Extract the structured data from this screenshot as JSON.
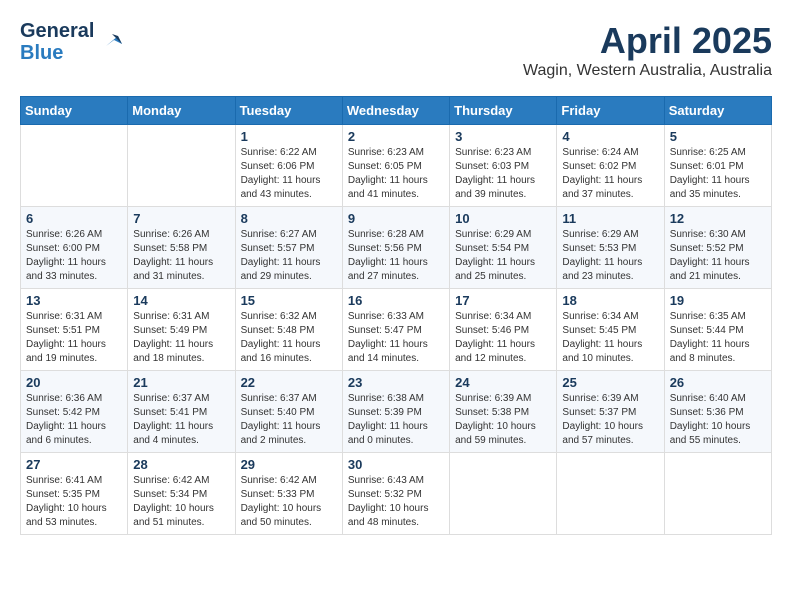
{
  "header": {
    "logo_line1": "General",
    "logo_line2": "Blue",
    "month": "April 2025",
    "location": "Wagin, Western Australia, Australia"
  },
  "weekdays": [
    "Sunday",
    "Monday",
    "Tuesday",
    "Wednesday",
    "Thursday",
    "Friday",
    "Saturday"
  ],
  "weeks": [
    [
      {
        "day": "",
        "sunrise": "",
        "sunset": "",
        "daylight": ""
      },
      {
        "day": "",
        "sunrise": "",
        "sunset": "",
        "daylight": ""
      },
      {
        "day": "1",
        "sunrise": "Sunrise: 6:22 AM",
        "sunset": "Sunset: 6:06 PM",
        "daylight": "Daylight: 11 hours and 43 minutes."
      },
      {
        "day": "2",
        "sunrise": "Sunrise: 6:23 AM",
        "sunset": "Sunset: 6:05 PM",
        "daylight": "Daylight: 11 hours and 41 minutes."
      },
      {
        "day": "3",
        "sunrise": "Sunrise: 6:23 AM",
        "sunset": "Sunset: 6:03 PM",
        "daylight": "Daylight: 11 hours and 39 minutes."
      },
      {
        "day": "4",
        "sunrise": "Sunrise: 6:24 AM",
        "sunset": "Sunset: 6:02 PM",
        "daylight": "Daylight: 11 hours and 37 minutes."
      },
      {
        "day": "5",
        "sunrise": "Sunrise: 6:25 AM",
        "sunset": "Sunset: 6:01 PM",
        "daylight": "Daylight: 11 hours and 35 minutes."
      }
    ],
    [
      {
        "day": "6",
        "sunrise": "Sunrise: 6:26 AM",
        "sunset": "Sunset: 6:00 PM",
        "daylight": "Daylight: 11 hours and 33 minutes."
      },
      {
        "day": "7",
        "sunrise": "Sunrise: 6:26 AM",
        "sunset": "Sunset: 5:58 PM",
        "daylight": "Daylight: 11 hours and 31 minutes."
      },
      {
        "day": "8",
        "sunrise": "Sunrise: 6:27 AM",
        "sunset": "Sunset: 5:57 PM",
        "daylight": "Daylight: 11 hours and 29 minutes."
      },
      {
        "day": "9",
        "sunrise": "Sunrise: 6:28 AM",
        "sunset": "Sunset: 5:56 PM",
        "daylight": "Daylight: 11 hours and 27 minutes."
      },
      {
        "day": "10",
        "sunrise": "Sunrise: 6:29 AM",
        "sunset": "Sunset: 5:54 PM",
        "daylight": "Daylight: 11 hours and 25 minutes."
      },
      {
        "day": "11",
        "sunrise": "Sunrise: 6:29 AM",
        "sunset": "Sunset: 5:53 PM",
        "daylight": "Daylight: 11 hours and 23 minutes."
      },
      {
        "day": "12",
        "sunrise": "Sunrise: 6:30 AM",
        "sunset": "Sunset: 5:52 PM",
        "daylight": "Daylight: 11 hours and 21 minutes."
      }
    ],
    [
      {
        "day": "13",
        "sunrise": "Sunrise: 6:31 AM",
        "sunset": "Sunset: 5:51 PM",
        "daylight": "Daylight: 11 hours and 19 minutes."
      },
      {
        "day": "14",
        "sunrise": "Sunrise: 6:31 AM",
        "sunset": "Sunset: 5:49 PM",
        "daylight": "Daylight: 11 hours and 18 minutes."
      },
      {
        "day": "15",
        "sunrise": "Sunrise: 6:32 AM",
        "sunset": "Sunset: 5:48 PM",
        "daylight": "Daylight: 11 hours and 16 minutes."
      },
      {
        "day": "16",
        "sunrise": "Sunrise: 6:33 AM",
        "sunset": "Sunset: 5:47 PM",
        "daylight": "Daylight: 11 hours and 14 minutes."
      },
      {
        "day": "17",
        "sunrise": "Sunrise: 6:34 AM",
        "sunset": "Sunset: 5:46 PM",
        "daylight": "Daylight: 11 hours and 12 minutes."
      },
      {
        "day": "18",
        "sunrise": "Sunrise: 6:34 AM",
        "sunset": "Sunset: 5:45 PM",
        "daylight": "Daylight: 11 hours and 10 minutes."
      },
      {
        "day": "19",
        "sunrise": "Sunrise: 6:35 AM",
        "sunset": "Sunset: 5:44 PM",
        "daylight": "Daylight: 11 hours and 8 minutes."
      }
    ],
    [
      {
        "day": "20",
        "sunrise": "Sunrise: 6:36 AM",
        "sunset": "Sunset: 5:42 PM",
        "daylight": "Daylight: 11 hours and 6 minutes."
      },
      {
        "day": "21",
        "sunrise": "Sunrise: 6:37 AM",
        "sunset": "Sunset: 5:41 PM",
        "daylight": "Daylight: 11 hours and 4 minutes."
      },
      {
        "day": "22",
        "sunrise": "Sunrise: 6:37 AM",
        "sunset": "Sunset: 5:40 PM",
        "daylight": "Daylight: 11 hours and 2 minutes."
      },
      {
        "day": "23",
        "sunrise": "Sunrise: 6:38 AM",
        "sunset": "Sunset: 5:39 PM",
        "daylight": "Daylight: 11 hours and 0 minutes."
      },
      {
        "day": "24",
        "sunrise": "Sunrise: 6:39 AM",
        "sunset": "Sunset: 5:38 PM",
        "daylight": "Daylight: 10 hours and 59 minutes."
      },
      {
        "day": "25",
        "sunrise": "Sunrise: 6:39 AM",
        "sunset": "Sunset: 5:37 PM",
        "daylight": "Daylight: 10 hours and 57 minutes."
      },
      {
        "day": "26",
        "sunrise": "Sunrise: 6:40 AM",
        "sunset": "Sunset: 5:36 PM",
        "daylight": "Daylight: 10 hours and 55 minutes."
      }
    ],
    [
      {
        "day": "27",
        "sunrise": "Sunrise: 6:41 AM",
        "sunset": "Sunset: 5:35 PM",
        "daylight": "Daylight: 10 hours and 53 minutes."
      },
      {
        "day": "28",
        "sunrise": "Sunrise: 6:42 AM",
        "sunset": "Sunset: 5:34 PM",
        "daylight": "Daylight: 10 hours and 51 minutes."
      },
      {
        "day": "29",
        "sunrise": "Sunrise: 6:42 AM",
        "sunset": "Sunset: 5:33 PM",
        "daylight": "Daylight: 10 hours and 50 minutes."
      },
      {
        "day": "30",
        "sunrise": "Sunrise: 6:43 AM",
        "sunset": "Sunset: 5:32 PM",
        "daylight": "Daylight: 10 hours and 48 minutes."
      },
      {
        "day": "",
        "sunrise": "",
        "sunset": "",
        "daylight": ""
      },
      {
        "day": "",
        "sunrise": "",
        "sunset": "",
        "daylight": ""
      },
      {
        "day": "",
        "sunrise": "",
        "sunset": "",
        "daylight": ""
      }
    ]
  ]
}
